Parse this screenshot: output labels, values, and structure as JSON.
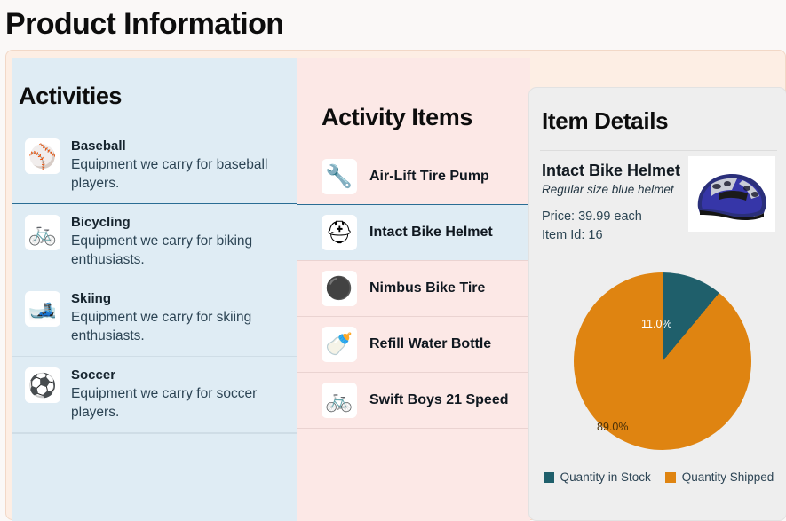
{
  "page": {
    "title": "Product Information"
  },
  "activities": {
    "heading": "Activities",
    "selected_index": 1,
    "items": [
      {
        "name": "Baseball",
        "description": "Equipment we carry for baseball players.",
        "icon": "baseball-icon",
        "glyph": "⚾"
      },
      {
        "name": "Bicycling",
        "description": "Equipment we carry for biking enthusiasts.",
        "icon": "bicycle-icon",
        "glyph": "🚲"
      },
      {
        "name": "Skiing",
        "description": "Equipment we carry for skiing enthusiasts.",
        "icon": "ski-boot-icon",
        "glyph": "🎿"
      },
      {
        "name": "Soccer",
        "description": "Equipment we carry for soccer players.",
        "icon": "soccer-ball-icon",
        "glyph": "⚽"
      }
    ]
  },
  "activity_items": {
    "heading": "Activity Items",
    "selected_index": 1,
    "items": [
      {
        "name": "Air-Lift Tire Pump",
        "icon": "tire-pump-icon",
        "glyph": "🔧"
      },
      {
        "name": "Intact Bike Helmet",
        "icon": "bike-helmet-icon",
        "glyph": "⛑"
      },
      {
        "name": "Nimbus Bike Tire",
        "icon": "bike-tire-icon",
        "glyph": "⚫"
      },
      {
        "name": "Refill Water Bottle",
        "icon": "water-bottle-icon",
        "glyph": "🍼"
      },
      {
        "name": "Swift Boys 21 Speed",
        "icon": "bicycle-icon",
        "glyph": "🚲"
      }
    ]
  },
  "item_details": {
    "heading": "Item Details",
    "name": "Intact Bike Helmet",
    "subtitle": "Regular size blue helmet",
    "price": "Price: 39.99 each",
    "item_id": "Item Id: 16",
    "image_icon": "bike-helmet-photo"
  },
  "chart_data": {
    "type": "pie",
    "title": "",
    "labels": [
      "Quantity in Stock",
      "Quantity Shipped"
    ],
    "values": [
      11.0,
      89.0
    ],
    "value_labels": [
      "11.0%",
      "89.0%"
    ],
    "colors": [
      "#1f5f6b",
      "#df8411"
    ],
    "legend_position": "bottom",
    "start_angle_deg": 0
  }
}
